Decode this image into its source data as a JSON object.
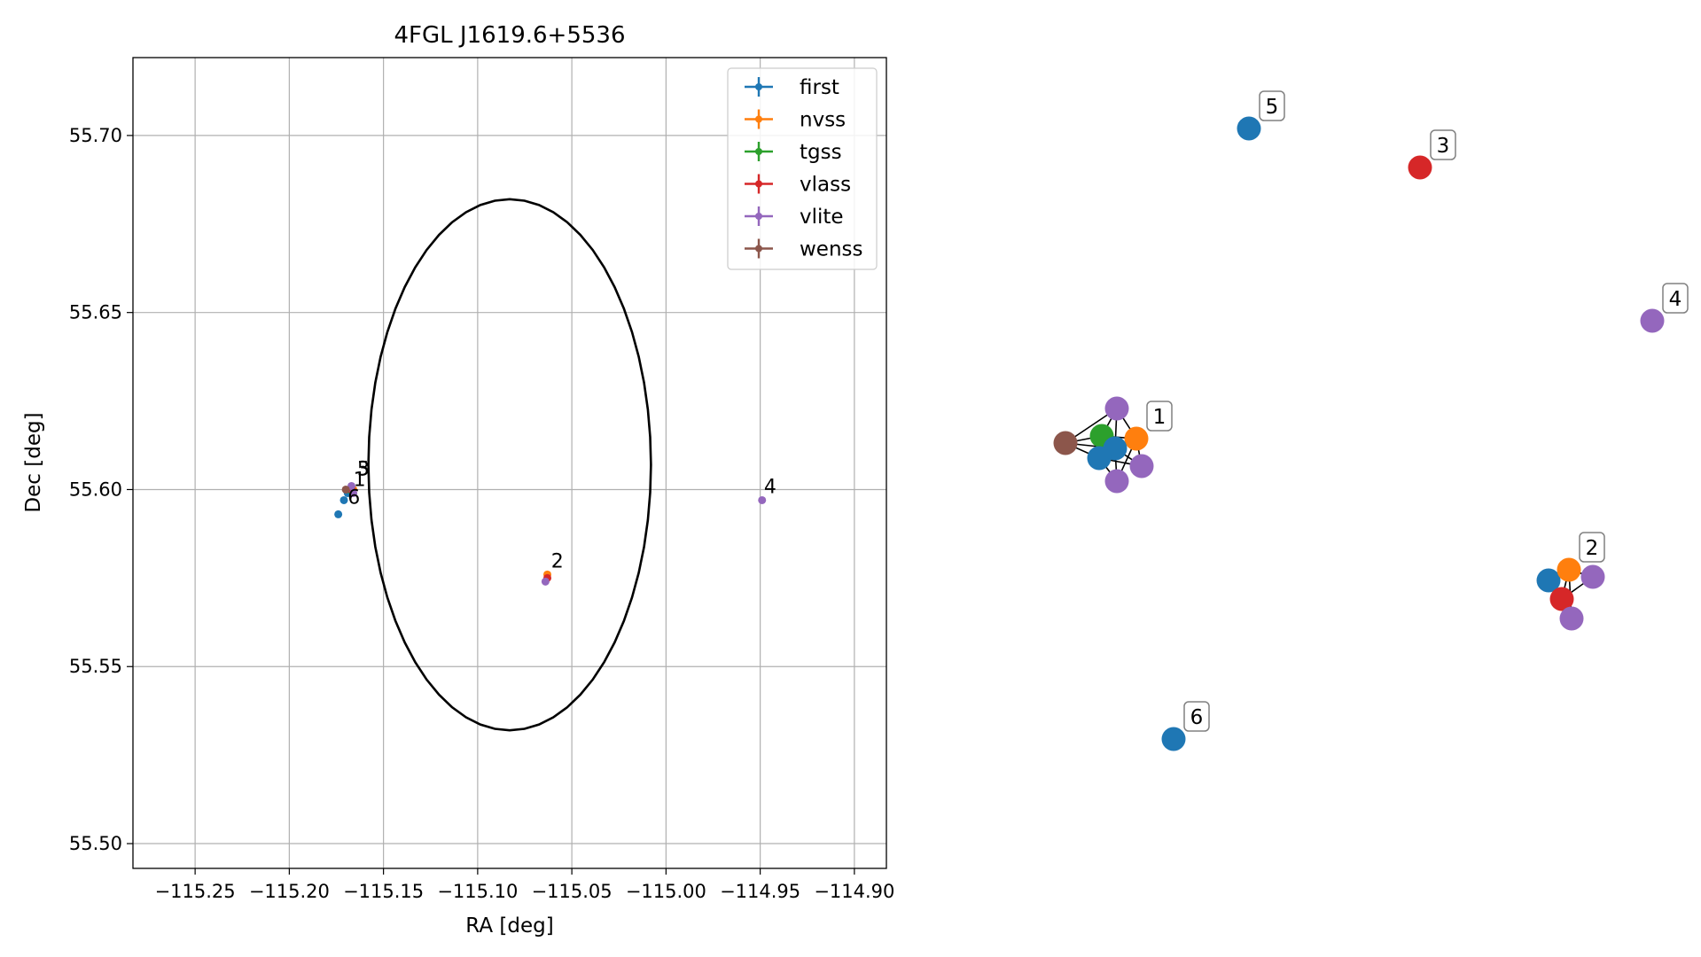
{
  "chart_data": [
    {
      "type": "scatter",
      "title": "4FGL J1619.6+5536",
      "xlabel": "RA [deg]",
      "ylabel": "Dec [deg]",
      "xlim": [
        -115.283,
        -114.883
      ],
      "ylim": [
        55.493,
        55.722
      ],
      "xticks": [
        -115.25,
        -115.2,
        -115.15,
        -115.1,
        -115.05,
        -115.0,
        -114.95,
        -114.9
      ],
      "xtick_labels": [
        "−115.25",
        "−115.20",
        "−115.15",
        "−115.10",
        "−115.05",
        "−115.00",
        "−114.95",
        "−114.90"
      ],
      "yticks": [
        55.5,
        55.55,
        55.6,
        55.65,
        55.7
      ],
      "ytick_labels": [
        "55.50",
        "55.55",
        "55.60",
        "55.65",
        "55.70"
      ],
      "grid": true,
      "legend_position": "top-right",
      "series": [
        {
          "name": "first",
          "color": "#1f77b4",
          "points": [
            [
              -115.169,
              55.599
            ],
            [
              -115.171,
              55.597
            ],
            [
              -115.174,
              55.593
            ]
          ]
        },
        {
          "name": "nvss",
          "color": "#ff7f0e",
          "points": [
            [
              -115.166,
              55.6
            ],
            [
              -115.063,
              55.576
            ]
          ]
        },
        {
          "name": "tgss",
          "color": "#2ca02c",
          "points": [
            [
              -115.168,
              55.6
            ]
          ]
        },
        {
          "name": "vlass",
          "color": "#d62728",
          "points": [
            [
              -115.167,
              55.6
            ],
            [
              -115.063,
              55.575
            ]
          ]
        },
        {
          "name": "vlite",
          "color": "#9467bd",
          "points": [
            [
              -115.167,
              55.601
            ],
            [
              -115.166,
              55.599
            ],
            [
              -115.064,
              55.574
            ],
            [
              -114.949,
              55.597
            ]
          ]
        },
        {
          "name": "wenss",
          "color": "#8c564b",
          "points": [
            [
              -115.17,
              55.6
            ]
          ]
        }
      ],
      "circle": {
        "center": [
          -115.083,
          55.607
        ],
        "radius": 0.075,
        "color": "#000000"
      },
      "point_labels": [
        {
          "text": "5",
          "x": -115.164,
          "y": 55.604
        },
        {
          "text": "3",
          "x": -115.164,
          "y": 55.604
        },
        {
          "text": "1",
          "x": -115.166,
          "y": 55.601
        },
        {
          "text": "6",
          "x": -115.169,
          "y": 55.596
        },
        {
          "text": "2",
          "x": -115.061,
          "y": 55.578
        },
        {
          "text": "4",
          "x": -114.948,
          "y": 55.599
        }
      ]
    },
    {
      "type": "network",
      "nodes": [
        {
          "id": "c1-vlite-a",
          "color": "#9467bd"
        },
        {
          "id": "c1-tgss",
          "color": "#2ca02c"
        },
        {
          "id": "c1-nvss",
          "color": "#ff7f0e"
        },
        {
          "id": "c1-wenss",
          "color": "#8c564b"
        },
        {
          "id": "c1-first-a",
          "color": "#1f77b4"
        },
        {
          "id": "c1-first-b",
          "color": "#1f77b4"
        },
        {
          "id": "c1-vlite-b",
          "color": "#9467bd"
        },
        {
          "id": "c1-vlite-c",
          "color": "#9467bd"
        },
        {
          "id": "c2-first",
          "color": "#1f77b4"
        },
        {
          "id": "c2-nvss",
          "color": "#ff7f0e"
        },
        {
          "id": "c2-vlite-a",
          "color": "#9467bd"
        },
        {
          "id": "c2-vlass",
          "color": "#d62728"
        },
        {
          "id": "c2-vlite-b",
          "color": "#9467bd"
        },
        {
          "id": "n5-first",
          "color": "#1f77b4"
        },
        {
          "id": "n3-vlass",
          "color": "#d62728"
        },
        {
          "id": "n4-vlite",
          "color": "#9467bd"
        },
        {
          "id": "n6-first",
          "color": "#1f77b4"
        }
      ],
      "edges": [
        [
          "c1-wenss",
          "c1-tgss"
        ],
        [
          "c1-wenss",
          "c1-first-a"
        ],
        [
          "c1-wenss",
          "c1-first-b"
        ],
        [
          "c1-wenss",
          "c1-vlite-a"
        ],
        [
          "c1-tgss",
          "c1-nvss"
        ],
        [
          "c1-tgss",
          "c1-first-a"
        ],
        [
          "c1-tgss",
          "c1-first-b"
        ],
        [
          "c1-tgss",
          "c1-vlite-a"
        ],
        [
          "c1-first-a",
          "c1-nvss"
        ],
        [
          "c1-first-a",
          "c1-vlite-b"
        ],
        [
          "c1-first-a",
          "c1-vlite-c"
        ],
        [
          "c1-first-a",
          "c1-vlite-a"
        ],
        [
          "c1-first-b",
          "c1-vlite-b"
        ],
        [
          "c1-first-b",
          "c1-vlite-c"
        ],
        [
          "c1-nvss",
          "c1-vlite-b"
        ],
        [
          "c1-nvss",
          "c1-vlite-c"
        ],
        [
          "c1-vlite-a",
          "c1-nvss"
        ],
        [
          "c2-first",
          "c2-nvss"
        ],
        [
          "c2-first",
          "c2-vlass"
        ],
        [
          "c2-nvss",
          "c2-vlite-a"
        ],
        [
          "c2-nvss",
          "c2-vlass"
        ],
        [
          "c2-vlass",
          "c2-vlite-a"
        ],
        [
          "c2-vlass",
          "c2-vlite-b"
        ],
        [
          "c2-nvss",
          "c2-vlite-b"
        ]
      ],
      "labels": [
        {
          "text": "1",
          "node": "c1-nvss"
        },
        {
          "text": "2",
          "node": "c2-nvss"
        },
        {
          "text": "3",
          "node": "n3-vlass"
        },
        {
          "text": "4",
          "node": "n4-vlite"
        },
        {
          "text": "5",
          "node": "n5-first"
        },
        {
          "text": "6",
          "node": "n6-first"
        }
      ]
    }
  ]
}
